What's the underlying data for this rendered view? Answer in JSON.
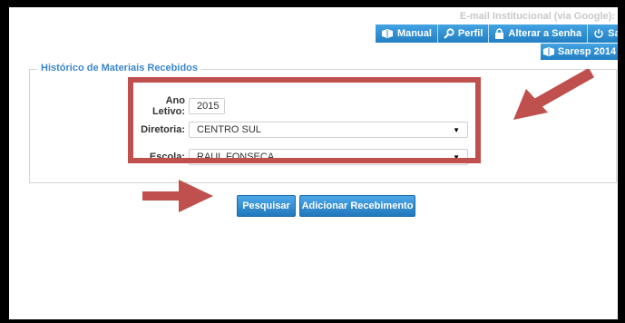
{
  "header": {
    "email_label": "E-mail Institucional (via Google):"
  },
  "nav": {
    "manual": "Manual",
    "perfil": "Perfil",
    "alterar_senha": "Alterar a Senha",
    "sair": "Sair",
    "saresp": "Saresp 2014"
  },
  "form": {
    "legend": "Histórico de Materiais Recebidos",
    "ano_label": "Ano Letivo:",
    "ano_value": "2015",
    "diretoria_label": "Diretoria:",
    "diretoria_value": "CENTRO SUL",
    "escola_label": "Escola:",
    "escola_value": "RAUL FONSECA"
  },
  "actions": {
    "pesquisar": "Pesquisar",
    "adicionar": "Adicionar Recebimento"
  },
  "colors": {
    "annotation": "#c0504d",
    "nav_blue": "#2e8fd1",
    "legend_blue": "#3d87c9"
  }
}
